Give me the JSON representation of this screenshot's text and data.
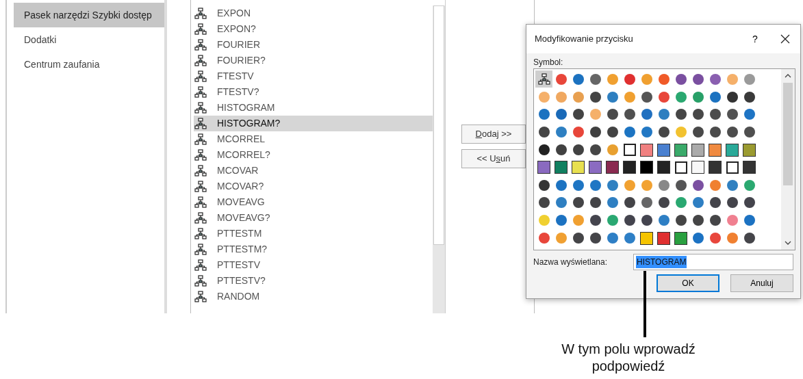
{
  "nav": {
    "items": [
      {
        "label": "Pasek narzędzi Szybki dostęp",
        "selected": true
      },
      {
        "label": "Dodatki",
        "selected": false
      },
      {
        "label": "Centrum zaufania",
        "selected": false
      }
    ]
  },
  "commands": {
    "items": [
      {
        "label": "EXPON",
        "selected": false
      },
      {
        "label": "EXPON?",
        "selected": false
      },
      {
        "label": "FOURIER",
        "selected": false
      },
      {
        "label": "FOURIER?",
        "selected": false
      },
      {
        "label": "FTESTV",
        "selected": false
      },
      {
        "label": "FTESTV?",
        "selected": false
      },
      {
        "label": "HISTOGRAM",
        "selected": false
      },
      {
        "label": "HISTOGRAM?",
        "selected": true
      },
      {
        "label": "MCORREL",
        "selected": false
      },
      {
        "label": "MCORREL?",
        "selected": false
      },
      {
        "label": "MCOVAR",
        "selected": false
      },
      {
        "label": "MCOVAR?",
        "selected": false
      },
      {
        "label": "MOVEAVG",
        "selected": false
      },
      {
        "label": "MOVEAVG?",
        "selected": false
      },
      {
        "label": "PTTESTM",
        "selected": false
      },
      {
        "label": "PTTESTM?",
        "selected": false
      },
      {
        "label": "PTTESTV",
        "selected": false
      },
      {
        "label": "PTTESTV?",
        "selected": false
      },
      {
        "label": "RANDOM",
        "selected": false
      }
    ]
  },
  "add_button": {
    "parts": [
      {
        "text": "D",
        "underlined": true
      },
      {
        "text": "odaj >>",
        "underlined": false
      }
    ]
  },
  "remove_button": {
    "parts": [
      {
        "text": "<< U",
        "underlined": false
      },
      {
        "text": "s",
        "underlined": true
      },
      {
        "text": "uń",
        "underlined": false
      }
    ]
  },
  "dialog": {
    "title": "Modyfikowanie przycisku",
    "help": "?",
    "symbol_label": "Symbol:",
    "symbol_rows": [
      [
        {
          "kind": "tree",
          "selected": true
        },
        {
          "kind": "glyph",
          "color": "#e8463a",
          "selected": false
        },
        {
          "kind": "glyph",
          "color": "#1c72c0",
          "selected": false
        },
        {
          "kind": "glyph",
          "color": "#666666",
          "selected": false
        },
        {
          "kind": "glyph",
          "color": "#f0a030",
          "selected": false
        },
        {
          "kind": "glyph",
          "color": "#e03030",
          "selected": false
        },
        {
          "kind": "glyph",
          "color": "#f0a030",
          "selected": false
        },
        {
          "kind": "glyph",
          "color": "#f05a28",
          "selected": false
        },
        {
          "kind": "glyph",
          "color": "#7a4fa0",
          "selected": false
        },
        {
          "kind": "glyph",
          "color": "#7a4fa0",
          "selected": false
        },
        {
          "kind": "glyph",
          "color": "#8a5fb0",
          "selected": false
        },
        {
          "kind": "glyph",
          "color": "#f5b06a",
          "selected": false
        },
        {
          "kind": "glyph",
          "color": "#9a9a9a",
          "selected": false
        }
      ],
      [
        {
          "kind": "glyph",
          "color": "#f5b06a",
          "selected": false
        },
        {
          "kind": "glyph",
          "color": "#f0a860",
          "selected": false
        },
        {
          "kind": "glyph",
          "color": "#e8a050",
          "selected": false
        },
        {
          "kind": "glyph",
          "color": "#444444",
          "selected": false
        },
        {
          "kind": "glyph",
          "color": "#2e7fc0",
          "selected": false
        },
        {
          "kind": "glyph",
          "color": "#f0a030",
          "selected": false
        },
        {
          "kind": "glyph",
          "color": "#555555",
          "selected": false
        },
        {
          "kind": "glyph",
          "color": "#e8463a",
          "selected": false
        },
        {
          "kind": "glyph",
          "color": "#2aa870",
          "selected": false
        },
        {
          "kind": "glyph",
          "color": "#28a068",
          "selected": false
        },
        {
          "kind": "glyph",
          "color": "#1c72c0",
          "selected": false
        },
        {
          "kind": "glyph",
          "color": "#333333",
          "selected": false
        },
        {
          "kind": "glyph",
          "color": "#3a3a3a",
          "selected": false
        }
      ],
      [
        {
          "kind": "glyph",
          "color": "#1c72c0",
          "selected": false
        },
        {
          "kind": "glyph",
          "color": "#1a6ab8",
          "selected": false
        },
        {
          "kind": "glyph",
          "color": "#444444",
          "selected": false
        },
        {
          "kind": "glyph",
          "color": "#f5b06a",
          "selected": false
        },
        {
          "kind": "glyph",
          "color": "#4a4a4a",
          "selected": false
        },
        {
          "kind": "glyph",
          "color": "#505050",
          "selected": false
        },
        {
          "kind": "glyph",
          "color": "#2070c0",
          "selected": false
        },
        {
          "kind": "glyph",
          "color": "#2e7fc0",
          "selected": false
        },
        {
          "kind": "glyph",
          "color": "#464646",
          "selected": false
        },
        {
          "kind": "glyph",
          "color": "#484848",
          "selected": false
        },
        {
          "kind": "glyph",
          "color": "#4c4c4c",
          "selected": false
        },
        {
          "kind": "glyph",
          "color": "#525252",
          "selected": false
        },
        {
          "kind": "glyph",
          "color": "#1e74c4",
          "selected": false
        }
      ],
      [
        {
          "kind": "glyph",
          "color": "#454545",
          "selected": false
        },
        {
          "kind": "glyph",
          "color": "#2e80c2",
          "selected": false
        },
        {
          "kind": "glyph",
          "color": "#e8463a",
          "selected": false
        },
        {
          "kind": "glyph",
          "color": "#404040",
          "selected": false
        },
        {
          "kind": "glyph",
          "color": "#434343",
          "selected": false
        },
        {
          "kind": "glyph",
          "color": "#1c74c2",
          "selected": false
        },
        {
          "kind": "glyph",
          "color": "#2278c4",
          "selected": false
        },
        {
          "kind": "glyph",
          "color": "#474747",
          "selected": false
        },
        {
          "kind": "glyph",
          "color": "#f2c230",
          "selected": false
        },
        {
          "kind": "glyph",
          "color": "#494949",
          "selected": false
        },
        {
          "kind": "glyph",
          "color": "#4b4b4b",
          "selected": false
        },
        {
          "kind": "glyph",
          "color": "#4d4d4d",
          "selected": false
        },
        {
          "kind": "glyph",
          "color": "#4f4f4f",
          "selected": false
        }
      ],
      [
        {
          "kind": "glyph",
          "color": "#222222",
          "selected": false
        },
        {
          "kind": "glyph",
          "color": "#414141",
          "selected": false
        },
        {
          "kind": "glyph",
          "color": "#424242",
          "selected": false
        },
        {
          "kind": "glyph",
          "color": "#464646",
          "selected": false
        },
        {
          "kind": "glyph",
          "color": "#e8a030",
          "selected": false
        },
        {
          "kind": "frame",
          "selected": false
        },
        {
          "kind": "swatch",
          "color": "#f08080",
          "selected": false
        },
        {
          "kind": "swatch",
          "color": "#4a80d0",
          "selected": false
        },
        {
          "kind": "swatch",
          "color": "#3aaa6a",
          "selected": false
        },
        {
          "kind": "swatch",
          "color": "#aaaaaa",
          "selected": false
        },
        {
          "kind": "swatch",
          "color": "#f08a40",
          "selected": false
        },
        {
          "kind": "swatch",
          "color": "#2aaa99",
          "selected": false
        },
        {
          "kind": "swatch",
          "color": "#9a9a30",
          "selected": false
        }
      ],
      [
        {
          "kind": "swatch",
          "color": "#8a6ac0",
          "selected": false
        },
        {
          "kind": "swatch",
          "color": "#118060",
          "selected": false
        },
        {
          "kind": "swatch",
          "color": "#e8e050",
          "selected": false
        },
        {
          "kind": "swatch",
          "color": "#8b6bc1",
          "selected": false
        },
        {
          "kind": "swatch",
          "color": "#8a2a50",
          "selected": false
        },
        {
          "kind": "swatch",
          "color": "#222222",
          "selected": false
        },
        {
          "kind": "swatch",
          "color": "#000000",
          "selected": false
        },
        {
          "kind": "swatch",
          "color": "#232323",
          "selected": false
        },
        {
          "kind": "frame",
          "selected": false
        },
        {
          "kind": "swatch",
          "color": "#f8f8f8",
          "selected": false
        },
        {
          "kind": "swatch",
          "color": "#333333",
          "selected": false
        },
        {
          "kind": "frame",
          "selected": false
        },
        {
          "kind": "swatch",
          "color": "#343434",
          "selected": false
        }
      ],
      [
        {
          "kind": "glyph",
          "color": "#353535",
          "selected": false
        },
        {
          "kind": "glyph",
          "color": "#1d73c1",
          "selected": false
        },
        {
          "kind": "glyph",
          "color": "#1e75c3",
          "selected": false
        },
        {
          "kind": "glyph",
          "color": "#1f76c4",
          "selected": false
        },
        {
          "kind": "glyph",
          "color": "#2f80c1",
          "selected": false
        },
        {
          "kind": "glyph",
          "color": "#f1a131",
          "selected": false
        },
        {
          "kind": "glyph",
          "color": "#f2a232",
          "selected": false
        },
        {
          "kind": "glyph",
          "color": "#888888",
          "selected": false
        },
        {
          "kind": "glyph",
          "color": "#555556",
          "selected": false
        },
        {
          "kind": "glyph",
          "color": "#7b50a1",
          "selected": false
        },
        {
          "kind": "glyph",
          "color": "#f08030",
          "selected": false
        },
        {
          "kind": "glyph",
          "color": "#3080c0",
          "selected": false
        },
        {
          "kind": "glyph",
          "color": "#2ba971",
          "selected": false
        }
      ],
      [
        {
          "kind": "glyph",
          "color": "#444445",
          "selected": false
        },
        {
          "kind": "glyph",
          "color": "#2e7fc1",
          "selected": false
        },
        {
          "kind": "glyph",
          "color": "#444446",
          "selected": false
        },
        {
          "kind": "glyph",
          "color": "#444447",
          "selected": false
        },
        {
          "kind": "glyph",
          "color": "#2e7fc2",
          "selected": false
        },
        {
          "kind": "glyph",
          "color": "#444448",
          "selected": false
        },
        {
          "kind": "glyph",
          "color": "#666667",
          "selected": false
        },
        {
          "kind": "glyph",
          "color": "#444449",
          "selected": false
        },
        {
          "kind": "glyph",
          "color": "#2aa871",
          "selected": false
        },
        {
          "kind": "glyph",
          "color": "#2e7fc3",
          "selected": false
        },
        {
          "kind": "glyph",
          "color": "#44444a",
          "selected": false
        },
        {
          "kind": "glyph",
          "color": "#44444b",
          "selected": false
        },
        {
          "kind": "glyph",
          "color": "#44444c",
          "selected": false
        }
      ],
      [
        {
          "kind": "glyph",
          "color": "#f0d030",
          "selected": false
        },
        {
          "kind": "glyph",
          "color": "#1c72c1",
          "selected": false
        },
        {
          "kind": "glyph",
          "color": "#f0a031",
          "selected": false
        },
        {
          "kind": "glyph",
          "color": "#44444d",
          "selected": false
        },
        {
          "kind": "glyph",
          "color": "#2aa872",
          "selected": false
        },
        {
          "kind": "glyph",
          "color": "#44444e",
          "selected": false
        },
        {
          "kind": "glyph",
          "color": "#44444f",
          "selected": false
        },
        {
          "kind": "glyph",
          "color": "#2e7fc4",
          "selected": false
        },
        {
          "kind": "glyph",
          "color": "#454545",
          "selected": false
        },
        {
          "kind": "glyph",
          "color": "#454546",
          "selected": false
        },
        {
          "kind": "glyph",
          "color": "#454547",
          "selected": false
        },
        {
          "kind": "glyph",
          "color": "#f08090",
          "selected": false
        },
        {
          "kind": "glyph",
          "color": "#1c72c2",
          "selected": false
        }
      ],
      [
        {
          "kind": "glyph",
          "color": "#e8463b",
          "selected": false
        },
        {
          "kind": "glyph",
          "color": "#f0a032",
          "selected": false
        },
        {
          "kind": "glyph",
          "color": "#454548",
          "selected": false
        },
        {
          "kind": "glyph",
          "color": "#454549",
          "selected": false
        },
        {
          "kind": "glyph",
          "color": "#2e7fc5",
          "selected": false
        },
        {
          "kind": "glyph",
          "color": "#2e7fc6",
          "selected": false
        },
        {
          "kind": "swatch",
          "color": "#f5c400",
          "selected": false
        },
        {
          "kind": "swatch",
          "color": "#e03030",
          "selected": false
        },
        {
          "kind": "swatch",
          "color": "#2aa040",
          "selected": false
        },
        {
          "kind": "glyph",
          "color": "#1c72c3",
          "selected": false
        },
        {
          "kind": "glyph",
          "color": "#e8463c",
          "selected": false
        },
        {
          "kind": "glyph",
          "color": "#f08031",
          "selected": false
        },
        {
          "kind": "glyph",
          "color": "#45454a",
          "selected": false
        }
      ]
    ],
    "name_label": "Nazwa wyświetlana:",
    "name_value": "HISTOGRAM",
    "name_selected": true,
    "ok_button": "OK",
    "cancel_button": "Anuluj"
  },
  "callout": {
    "text": "W tym polu wprowadź podpowiedź"
  }
}
